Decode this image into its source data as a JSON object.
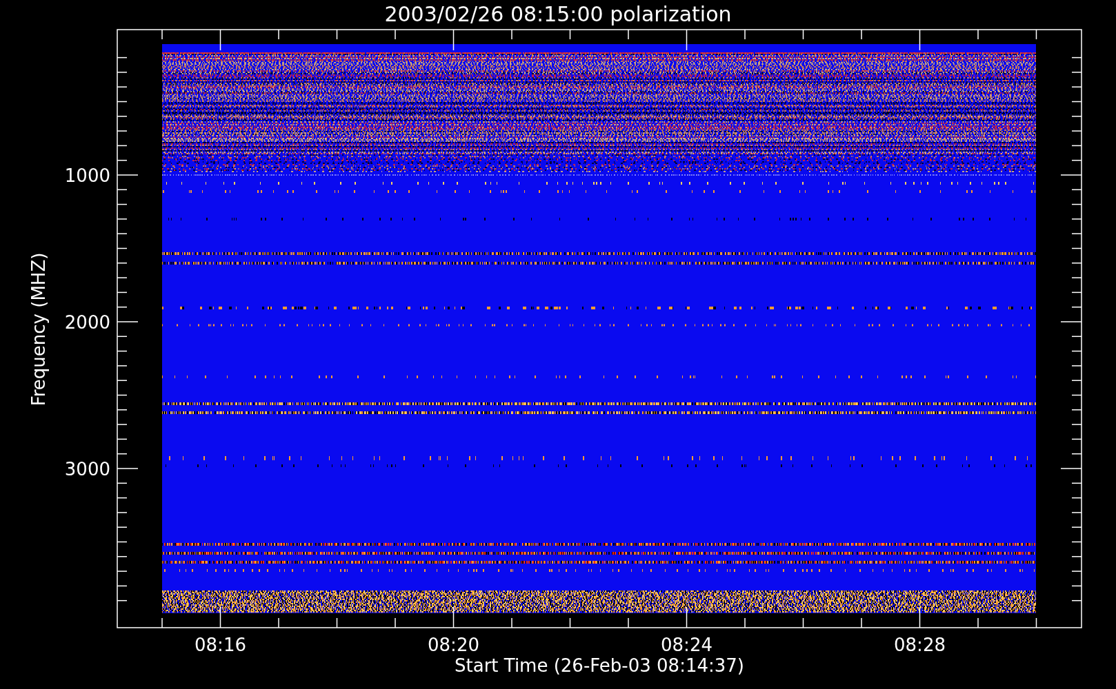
{
  "title": "2003/02/26 08:15:00 polarization",
  "y_axis": {
    "label": "Frequency (MHZ)",
    "ticks": [
      "1000",
      "2000",
      "3000"
    ]
  },
  "x_axis": {
    "label": "Start Time (26-Feb-03 08:14:37)",
    "ticks": [
      "08:16",
      "08:20",
      "08:24",
      "08:28"
    ]
  }
}
